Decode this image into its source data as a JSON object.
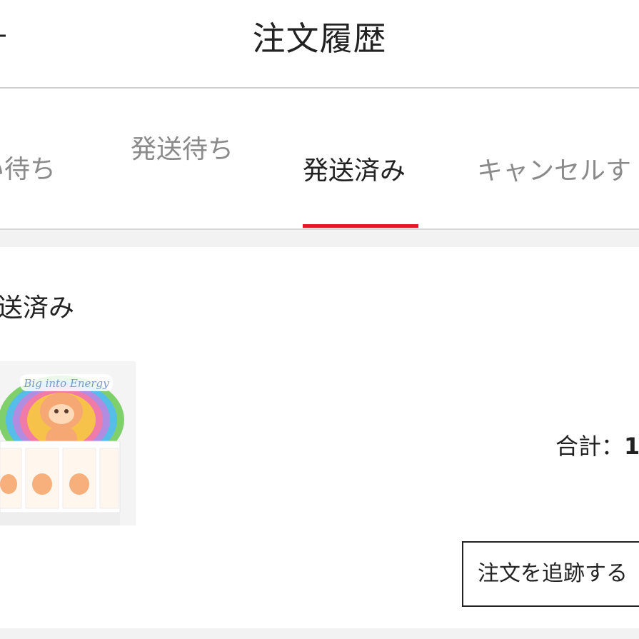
{
  "header": {
    "title": "注文履歴",
    "back_icon": "chevron-left-icon"
  },
  "tabs": [
    {
      "label": "い待ち",
      "active": false
    },
    {
      "label": "発送待ち",
      "active": false
    },
    {
      "label": "発送済み",
      "active": true
    },
    {
      "label": "キャンセルす",
      "active": false
    }
  ],
  "order": {
    "status": "送済み",
    "product_image_text": "Big into Energy",
    "total_label": "合計：",
    "total_value": "1",
    "track_button": "注文を追跡する"
  },
  "colors": {
    "accent": "#e3162c",
    "text": "#222222",
    "muted_text": "#8a8a8a",
    "divider": "#d7d7d7",
    "band": "#f2f2f2"
  }
}
